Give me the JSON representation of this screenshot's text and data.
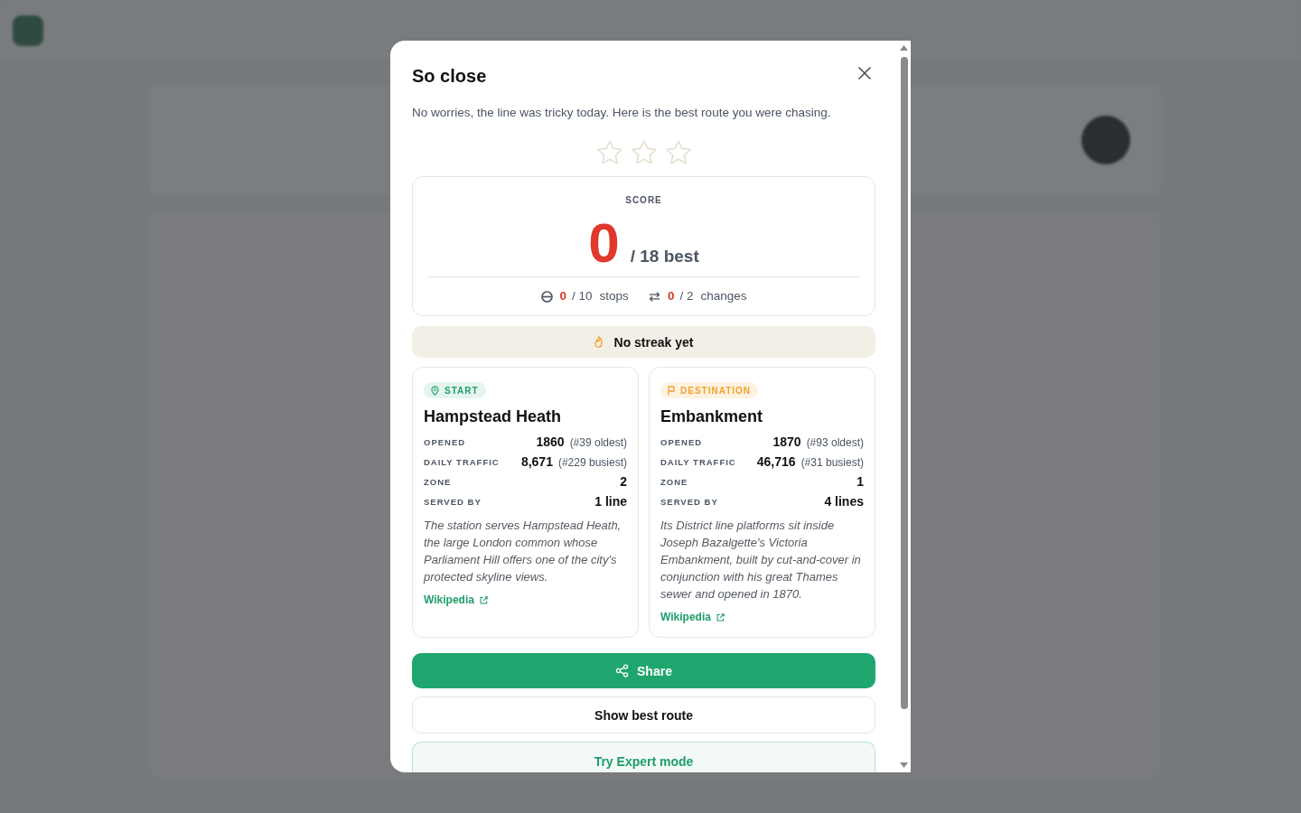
{
  "dialog": {
    "title": "So close",
    "message": "No worries, the line was tricky today. Here is the best route you were chasing.",
    "stars": 0,
    "score": {
      "label": "SCORE",
      "value": "0",
      "best": "/ 18 best"
    },
    "stats": [
      {
        "kind": "stops",
        "value": "0",
        "total": "/ 10",
        "unit": "stops"
      },
      {
        "kind": "changes",
        "value": "0",
        "total": "/ 2",
        "unit": "changes"
      }
    ],
    "streak": "No streak yet",
    "stations": [
      {
        "kind": "start",
        "badge": "START",
        "name": "Hampstead Heath",
        "facts": [
          {
            "label": "OPENED",
            "value": "1860",
            "rank": "(#39 oldest)"
          },
          {
            "label": "DAILY TRAFFIC",
            "value": "8,671",
            "rank": "(#229 busiest)"
          },
          {
            "label": "ZONE",
            "value": "2"
          },
          {
            "label": "SERVED BY",
            "value": "1 line"
          }
        ],
        "description": "The station serves Hampstead Heath, the large London common whose Parliament Hill offers one of the city's protected skyline views.",
        "link": "Wikipedia"
      },
      {
        "kind": "destination",
        "badge": "DESTINATION",
        "name": "Embankment",
        "facts": [
          {
            "label": "OPENED",
            "value": "1870",
            "rank": "(#93 oldest)"
          },
          {
            "label": "DAILY TRAFFIC",
            "value": "46,716",
            "rank": "(#31 busiest)"
          },
          {
            "label": "ZONE",
            "value": "1"
          },
          {
            "label": "SERVED BY",
            "value": "4 lines"
          }
        ],
        "description": "Its District line platforms sit inside Joseph Bazalgette's Victoria Embankment, built by cut-and-cover in conjunction with his great Thames sewer and opened in 1870.",
        "link": "Wikipedia"
      }
    ],
    "buttons": [
      {
        "kind": "primary",
        "label": "Share"
      },
      {
        "kind": "secondary",
        "label": "Show best route"
      },
      {
        "kind": "accent",
        "label": "Try Expert mode"
      }
    ]
  }
}
